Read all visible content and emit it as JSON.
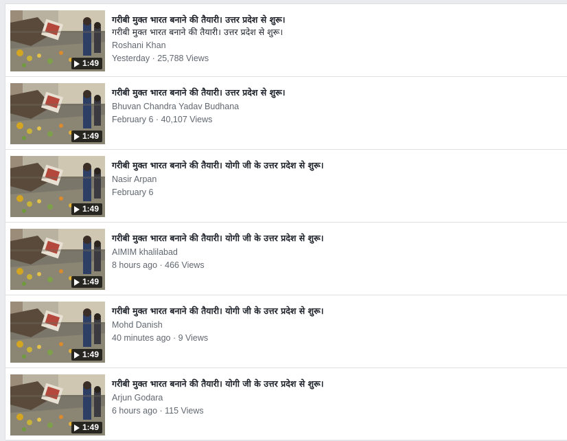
{
  "colors": {
    "page_background": "#e9ebee",
    "card_background": "#ffffff",
    "divider": "#dddfe2",
    "title_text": "#1d2129",
    "secondary_text": "#616770"
  },
  "videos": [
    {
      "title": "गरीबी मुक्त भारत बनाने की तैयारी। उत्तर प्रदेश से शुरू।",
      "description": "गरीबी मुक्त भारत बनाने की तैयारी। उत्तर प्रदेश से शुरू।",
      "author": "Roshani Khan",
      "meta": "Yesterday · 25,788 Views",
      "duration": "1:49"
    },
    {
      "title": "गरीबी मुक्त भारत बनाने की तैयारी। उत्तर प्रदेश से शुरू।",
      "author": "Bhuvan Chandra Yadav Budhana",
      "meta": "February 6 · 40,107 Views",
      "duration": "1:49"
    },
    {
      "title": "गरीबी मुक्त भारत बनाने की तैयारी। योगी जी के उत्तर प्रदेश से शुरू।",
      "author": "Nasir Arpan",
      "meta": "February 6",
      "duration": "1:49"
    },
    {
      "title": "गरीबी मुक्त भारत बनाने की तैयारी। योगी जी के उत्तर प्रदेश से शुरू।",
      "author": "AIMIM khalilabad",
      "meta": "8 hours ago · 466 Views",
      "duration": "1:49"
    },
    {
      "title": "गरीबी मुक्त भारत बनाने की तैयारी। योगी जी के उत्तर प्रदेश से शुरू।",
      "author": "Mohd Danish",
      "meta": "40 minutes ago · 9 Views",
      "duration": "1:49"
    },
    {
      "title": "गरीबी मुक्त भारत बनाने की तैयारी। योगी जी के उत्तर प्रदेश से शुरू।",
      "author": "Arjun Godara",
      "meta": "6 hours ago · 115 Views",
      "duration": "1:49"
    }
  ]
}
